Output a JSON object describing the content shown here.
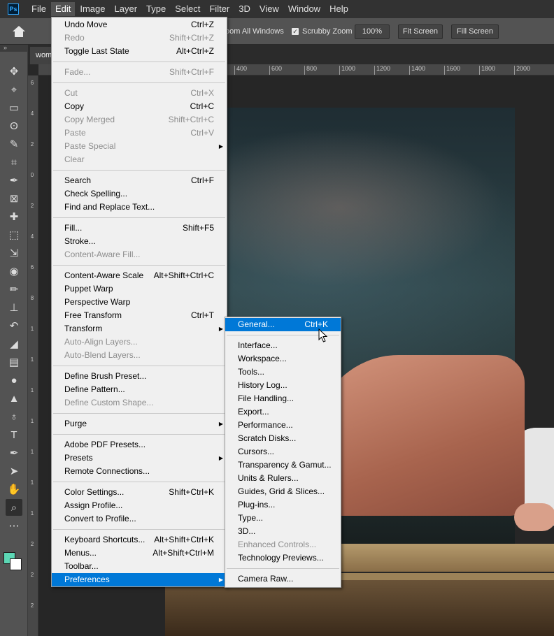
{
  "app": {
    "logo": "Ps"
  },
  "menubar": [
    "File",
    "Edit",
    "Image",
    "Layer",
    "Type",
    "Select",
    "Filter",
    "3D",
    "View",
    "Window",
    "Help"
  ],
  "options_bar": {
    "zoom_all_windows": "oom All Windows",
    "scrubby_zoom": "Scrubby Zoom",
    "scrubby_checked": true,
    "zoom_value": "100%",
    "fit_screen": "Fit Screen",
    "fill_screen": "Fill Screen"
  },
  "collapse_glyph": "»",
  "document_tab": "wom",
  "ruler_top": [
    "400",
    "600",
    "800",
    "1000",
    "1200",
    "1400",
    "1600",
    "1800",
    "2000"
  ],
  "ruler_left": [
    "6",
    "4",
    "2",
    "0",
    "2",
    "4",
    "6",
    "8",
    "1",
    "1",
    "1",
    "1",
    "1",
    "1",
    "1",
    "2",
    "2",
    "2"
  ],
  "toolbar_icons": [
    "move-icon",
    "artboard-icon",
    "marquee-icon",
    "lasso-icon",
    "quick-select-icon",
    "crop-icon",
    "eyedropper-icon",
    "frame-icon",
    "spot-heal-icon",
    "patch-icon",
    "content-aware-icon",
    "red-eye-icon",
    "brush-icon",
    "stamp-icon",
    "history-brush-icon",
    "eraser-icon",
    "gradient-icon",
    "blur-icon",
    "sharpen-icon",
    "dodge-icon",
    "type-icon",
    "pen-icon",
    "path-select-icon",
    "hand-icon",
    "zoom-icon",
    "more-icon"
  ],
  "colors": {
    "foreground": "#5cd7b5",
    "background": "#ffffff",
    "menu_highlight": "#0078d7"
  },
  "edit_menu": [
    {
      "label": "Undo Move",
      "u": "U",
      "shortcut": "Ctrl+Z"
    },
    {
      "label": "Redo",
      "shortcut": "Shift+Ctrl+Z",
      "disabled": true
    },
    {
      "label": "Toggle Last State",
      "shortcut": "Alt+Ctrl+Z"
    },
    {
      "sep": true
    },
    {
      "label": "Fade...",
      "shortcut": "Shift+Ctrl+F",
      "disabled": true
    },
    {
      "sep": true
    },
    {
      "label": "Cut",
      "shortcut": "Ctrl+X",
      "disabled": true
    },
    {
      "label": "Copy",
      "shortcut": "Ctrl+C"
    },
    {
      "label": "Copy Merged",
      "shortcut": "Shift+Ctrl+C",
      "disabled": true
    },
    {
      "label": "Paste",
      "shortcut": "Ctrl+V",
      "disabled": true
    },
    {
      "label": "Paste Special",
      "submenu": true,
      "disabled": true
    },
    {
      "label": "Clear",
      "disabled": true
    },
    {
      "sep": true
    },
    {
      "label": "Search",
      "shortcut": "Ctrl+F"
    },
    {
      "label": "Check Spelling..."
    },
    {
      "label": "Find and Replace Text..."
    },
    {
      "sep": true
    },
    {
      "label": "Fill...",
      "shortcut": "Shift+F5"
    },
    {
      "label": "Stroke..."
    },
    {
      "label": "Content-Aware Fill...",
      "disabled": true
    },
    {
      "sep": true
    },
    {
      "label": "Content-Aware Scale",
      "shortcut": "Alt+Shift+Ctrl+C"
    },
    {
      "label": "Puppet Warp"
    },
    {
      "label": "Perspective Warp"
    },
    {
      "label": "Free Transform",
      "shortcut": "Ctrl+T"
    },
    {
      "label": "Transform",
      "submenu": true
    },
    {
      "label": "Auto-Align Layers...",
      "disabled": true
    },
    {
      "label": "Auto-Blend Layers...",
      "disabled": true
    },
    {
      "sep": true
    },
    {
      "label": "Define Brush Preset..."
    },
    {
      "label": "Define Pattern..."
    },
    {
      "label": "Define Custom Shape...",
      "disabled": true
    },
    {
      "sep": true
    },
    {
      "label": "Purge",
      "submenu": true
    },
    {
      "sep": true
    },
    {
      "label": "Adobe PDF Presets..."
    },
    {
      "label": "Presets",
      "submenu": true
    },
    {
      "label": "Remote Connections..."
    },
    {
      "sep": true
    },
    {
      "label": "Color Settings...",
      "shortcut": "Shift+Ctrl+K"
    },
    {
      "label": "Assign Profile..."
    },
    {
      "label": "Convert to Profile..."
    },
    {
      "sep": true
    },
    {
      "label": "Keyboard Shortcuts...",
      "shortcut": "Alt+Shift+Ctrl+K"
    },
    {
      "label": "Menus...",
      "shortcut": "Alt+Shift+Ctrl+M"
    },
    {
      "label": "Toolbar..."
    },
    {
      "label": "Preferences",
      "submenu": true,
      "highlight": true
    }
  ],
  "preferences_menu": [
    {
      "label": "General...",
      "shortcut": "Ctrl+K",
      "highlight": true
    },
    {
      "sep": true
    },
    {
      "label": "Interface..."
    },
    {
      "label": "Workspace..."
    },
    {
      "label": "Tools..."
    },
    {
      "label": "History Log..."
    },
    {
      "label": "File Handling..."
    },
    {
      "label": "Export..."
    },
    {
      "label": "Performance..."
    },
    {
      "label": "Scratch Disks..."
    },
    {
      "label": "Cursors..."
    },
    {
      "label": "Transparency & Gamut..."
    },
    {
      "label": "Units & Rulers..."
    },
    {
      "label": "Guides, Grid & Slices..."
    },
    {
      "label": "Plug-ins..."
    },
    {
      "label": "Type..."
    },
    {
      "label": "3D..."
    },
    {
      "label": "Enhanced Controls...",
      "disabled": true
    },
    {
      "label": "Technology Previews..."
    },
    {
      "sep": true
    },
    {
      "label": "Camera Raw..."
    }
  ]
}
